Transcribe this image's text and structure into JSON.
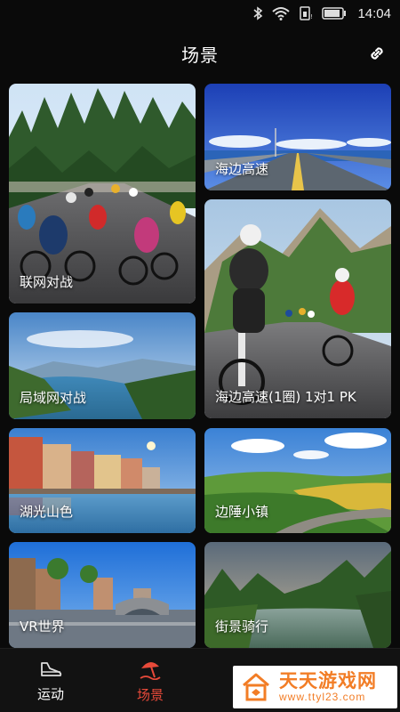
{
  "status_bar": {
    "time": "14:04"
  },
  "header": {
    "title": "场景"
  },
  "scenes": [
    {
      "label": "联网对战"
    },
    {
      "label": "海边高速"
    },
    {
      "label": "海边高速(1圈) 1对1 PK"
    },
    {
      "label": "局域网对战"
    },
    {
      "label": "湖光山色"
    },
    {
      "label": "边陲小镇"
    },
    {
      "label": "VR世界"
    },
    {
      "label": "街景骑行"
    }
  ],
  "tabs": [
    {
      "label": "运动",
      "icon": "shoe-icon"
    },
    {
      "label": "场景",
      "icon": "beach-umbrella-icon"
    }
  ],
  "watermark": {
    "text": "天天游戏网",
    "url": "www.ttyl23.com"
  },
  "colors": {
    "accent": "#e84a3a",
    "background": "#0a0a0a",
    "watermark": "#f27d26"
  }
}
